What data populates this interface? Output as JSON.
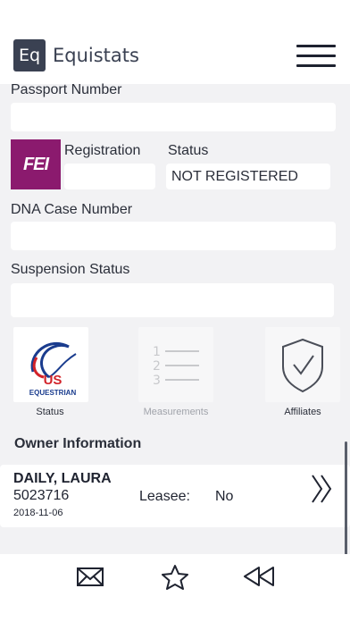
{
  "header": {
    "logo_text": "Eq",
    "app_title": "Equistats",
    "menu_icon": "hamburger-menu-icon"
  },
  "form": {
    "passport_label": "Passport Number",
    "passport_value": "",
    "fei_logo_text": "FEI",
    "registration_label": "Registration",
    "registration_value": "",
    "status_label": "Status",
    "status_value": "NOT REGISTERED",
    "dna_label": "DNA Case Number",
    "dna_value": "",
    "suspension_label": "Suspension Status",
    "suspension_value": ""
  },
  "tiles": {
    "status_label": "Status",
    "us_equestrian_logo_text": "US",
    "us_equestrian_logo_subtext": "EQUESTRIAN",
    "measurements_label": "Measurements",
    "affiliates_label": "Affiliates",
    "measurements_numbers": [
      "1",
      "2",
      "3"
    ]
  },
  "owner": {
    "section_title": "Owner Information",
    "name": "DAILY, LAURA",
    "id": "5023716",
    "leasee_label": "Leasee:",
    "leasee_value": "No",
    "date": "2018-11-06"
  },
  "colors": {
    "fei_purple": "#8b1a6e",
    "usef_blue": "#1a3c8e",
    "usef_red": "#d2232a",
    "logo_bg": "#3a4152"
  },
  "bottom_bar": {
    "icons": [
      "mail-icon",
      "star-icon",
      "rewind-icon"
    ]
  }
}
